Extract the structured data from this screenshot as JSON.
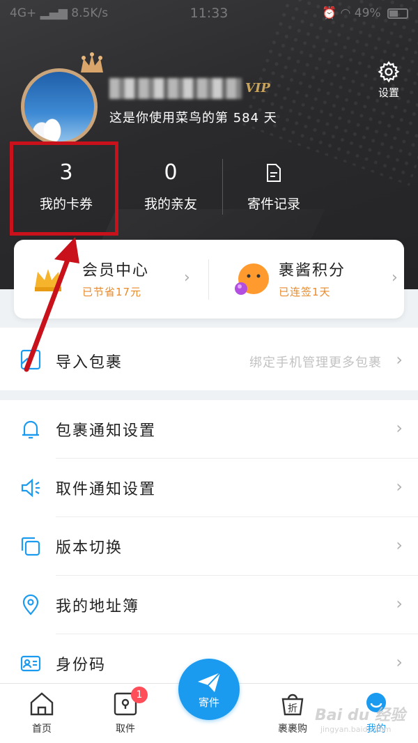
{
  "status_bar": {
    "network": "4G+",
    "speed": "8.5K/s",
    "time": "11:33",
    "battery": "49%"
  },
  "header": {
    "settings_label": "设置",
    "vip_label": "VIP",
    "days_text": "这是你使用菜鸟的第 584 天"
  },
  "stats": {
    "coupons_count": "3",
    "coupons_label": "我的卡券",
    "friends_count": "0",
    "friends_label": "我的亲友",
    "records_label": "寄件记录"
  },
  "member_card": {
    "member_title": "会员中心",
    "member_sub": "已节省17元",
    "points_title": "裹酱积分",
    "points_sub": "已连签1天"
  },
  "import_row": {
    "label": "导入包裹",
    "hint": "绑定手机管理更多包裹"
  },
  "menu": [
    {
      "label": "包裹通知设置",
      "icon": "bell-icon"
    },
    {
      "label": "取件通知设置",
      "icon": "speaker-icon"
    },
    {
      "label": "版本切换",
      "icon": "layers-icon"
    },
    {
      "label": "我的地址簿",
      "icon": "location-pin-icon"
    },
    {
      "label": "身份码",
      "icon": "id-card-icon"
    }
  ],
  "tabbar": {
    "home": "首页",
    "pickup": "取件",
    "pickup_badge": "1",
    "send": "寄件",
    "shop": "裹裹购",
    "me": "我的"
  },
  "colors": {
    "accent": "#1b9bf0",
    "highlight": "#c8111a",
    "orange_text": "#e98a2a",
    "header_bg": "#2a2a2c"
  }
}
